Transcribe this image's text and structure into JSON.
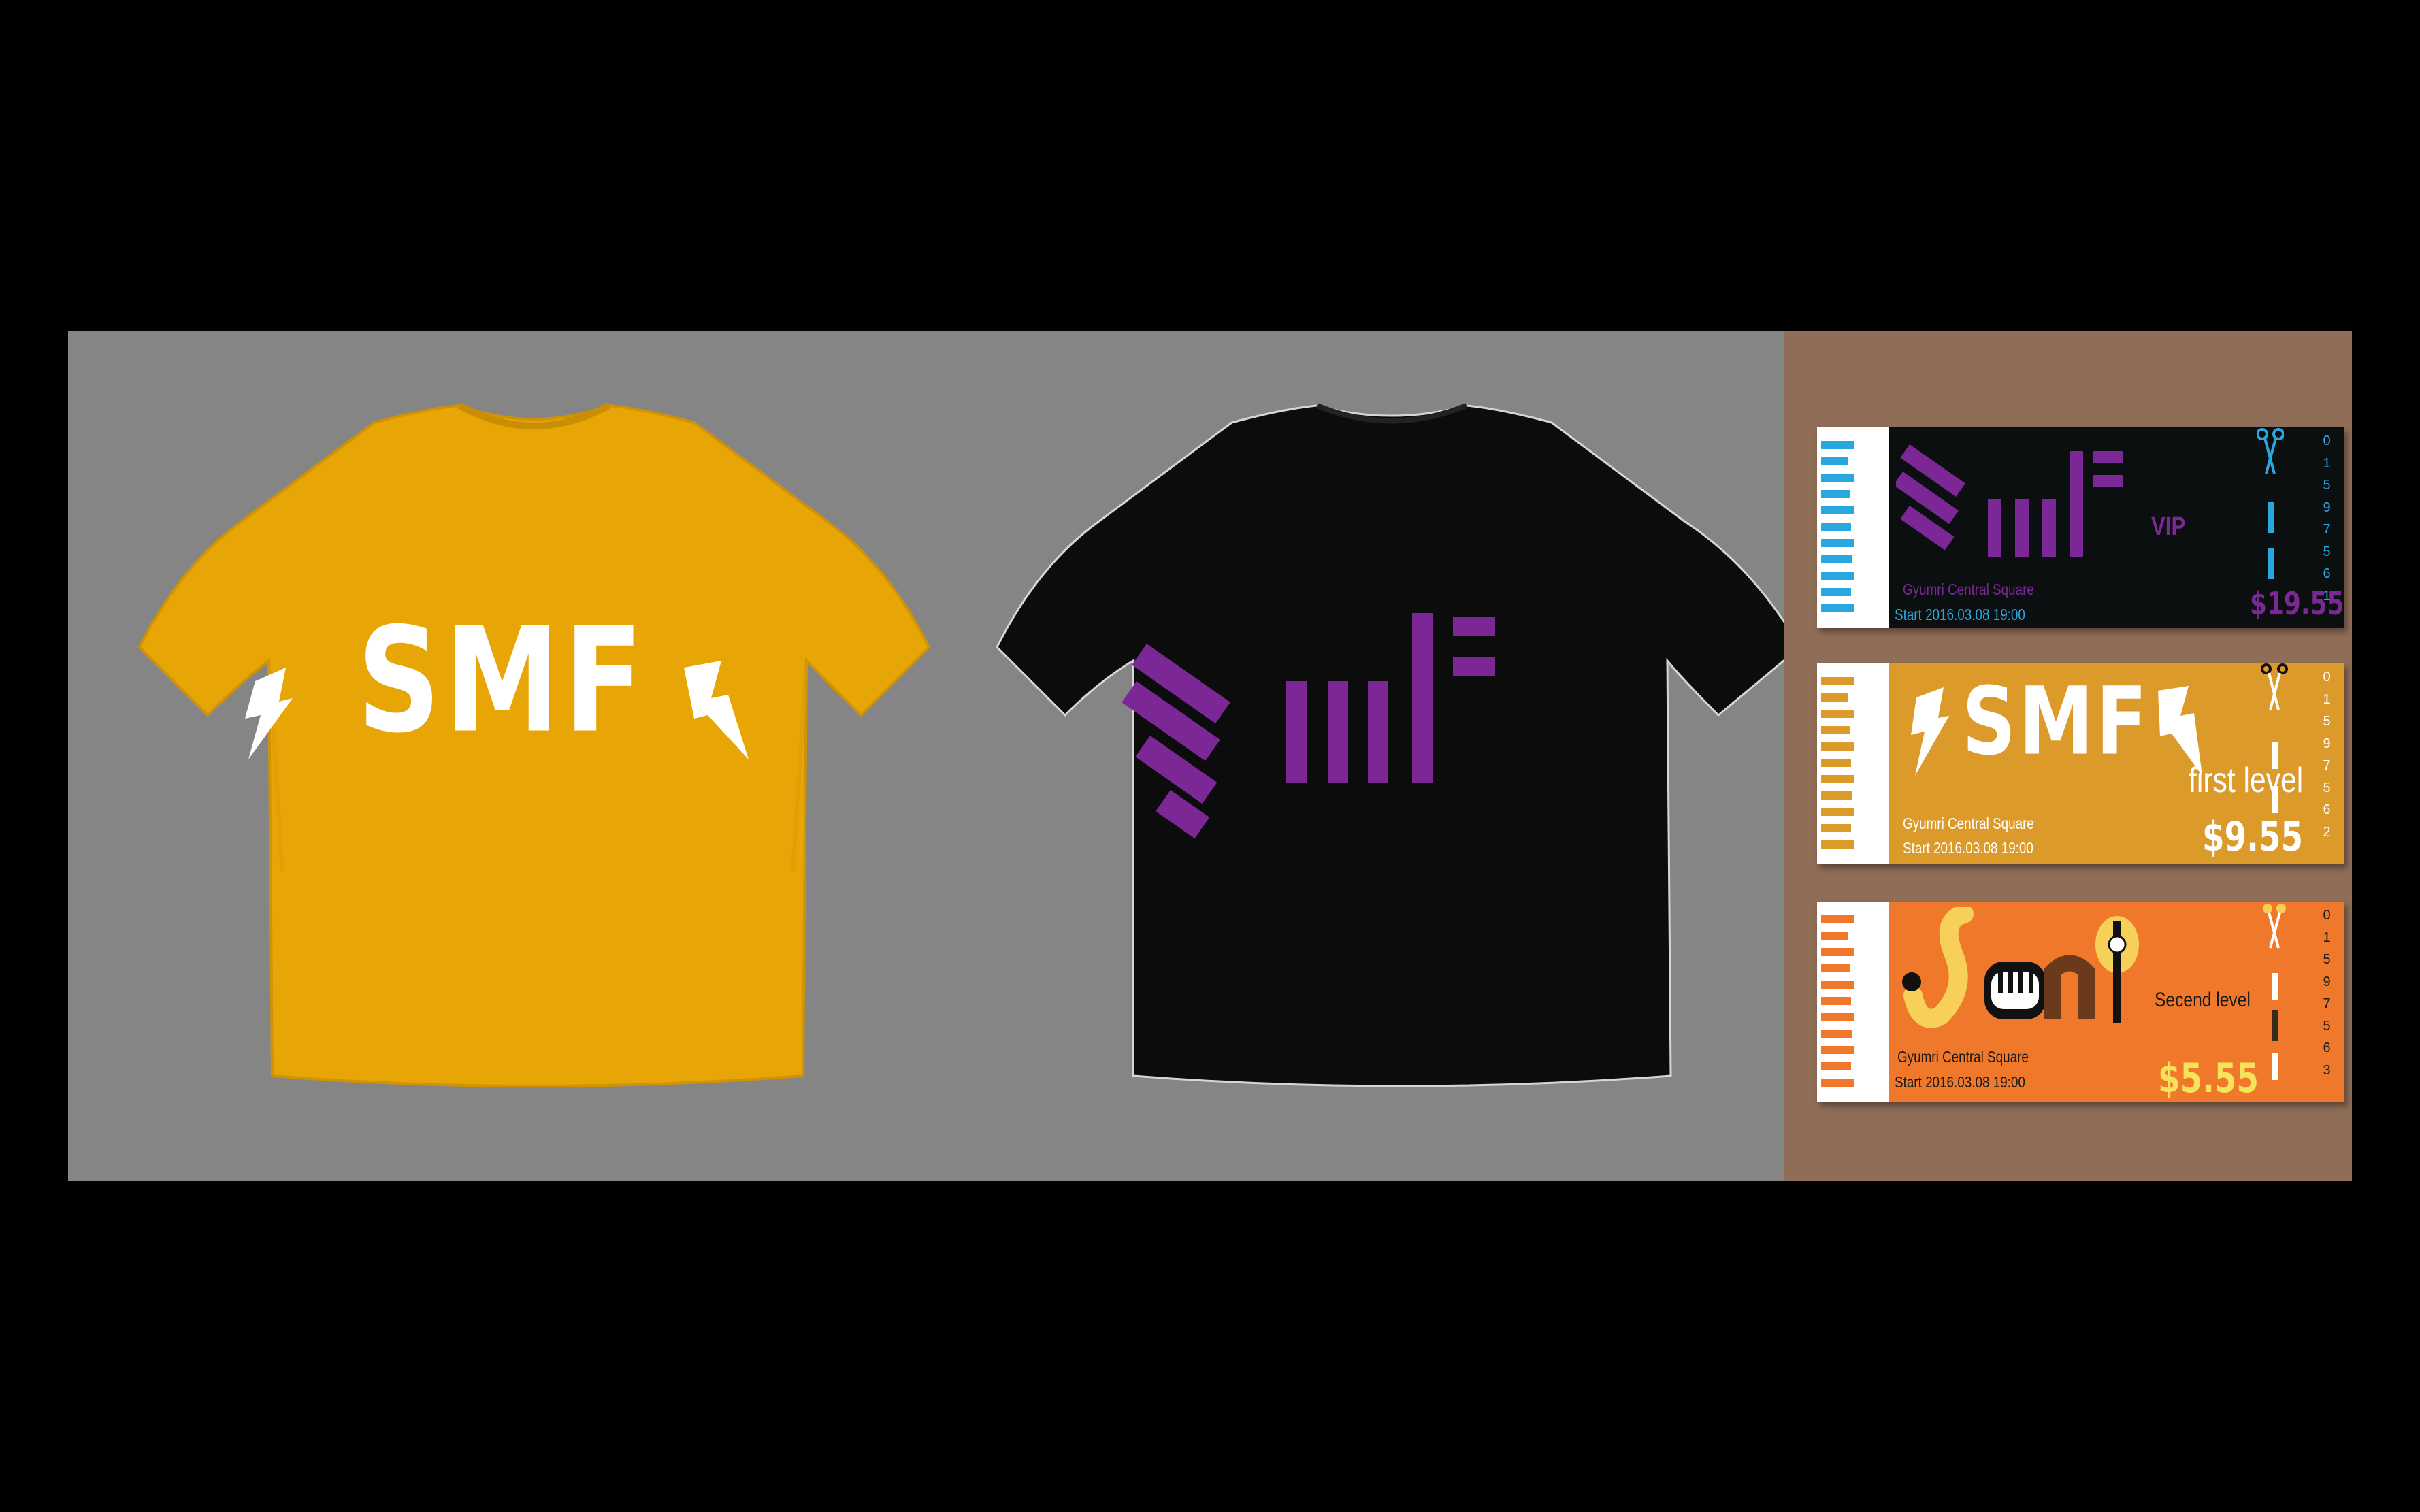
{
  "colors": {
    "page_bg": "#000000",
    "canvas_bg": "#858585",
    "board_bg": "#8f6d57",
    "mustard": "#e8a606",
    "shirt_black": "#0c0c0c",
    "purple": "#7b2896",
    "cyan": "#29a8df",
    "ticket_gold": "#dc9a2b",
    "ticket_orange": "#f0782a"
  },
  "shirt_yellow": {
    "logo_text": "SMF",
    "logo_style": "lightning-bolts",
    "color": "mustard"
  },
  "shirt_black": {
    "logo_style": "striped-smf",
    "color": "purple"
  },
  "tickets": [
    {
      "id": "vip",
      "theme": "black",
      "level": "VIP",
      "venue": "Gyumri Central Square",
      "start": "Start 2016.03.08 19:00",
      "price": "$19.55",
      "serial": [
        "0",
        "1",
        "5",
        "9",
        "7",
        "5",
        "6",
        "1"
      ]
    },
    {
      "id": "first",
      "theme": "gold",
      "logo_text": "SMF",
      "level": "first level",
      "venue": "Gyumri Central Square",
      "start": "Start 2016.03.08 19:00",
      "price": "$9.55",
      "serial": [
        "0",
        "1",
        "5",
        "9",
        "7",
        "5",
        "6",
        "2"
      ]
    },
    {
      "id": "second",
      "theme": "orange",
      "level": "Secend level",
      "venue": "Gyumri Central Square",
      "start": "Start 2016.03.08 19:00",
      "price": "$5.55",
      "serial": [
        "0",
        "1",
        "5",
        "9",
        "7",
        "5",
        "6",
        "3"
      ]
    }
  ]
}
